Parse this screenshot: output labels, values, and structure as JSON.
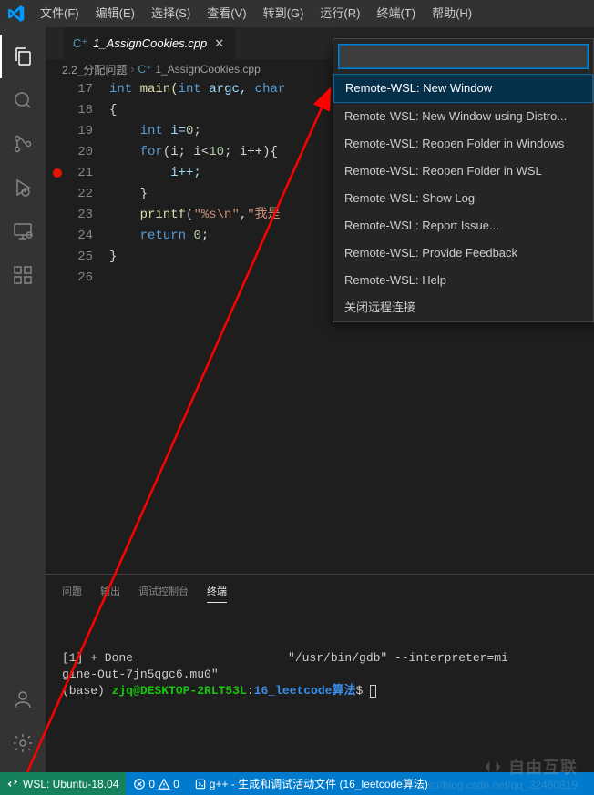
{
  "menubar": [
    "文件(F)",
    "编辑(E)",
    "选择(S)",
    "查看(V)",
    "转到(G)",
    "运行(R)",
    "终端(T)",
    "帮助(H)"
  ],
  "tab": {
    "label": "1_AssignCookies.cpp"
  },
  "breadcrumb": {
    "folder": "2.2_分配问题",
    "file": "1_AssignCookies.cpp"
  },
  "line_numbers": [
    "17",
    "18",
    "19",
    "20",
    "21",
    "22",
    "23",
    "24",
    "25",
    "26"
  ],
  "code": {
    "l17_a": "int",
    "l17_b": " main(",
    "l17_c": "int",
    "l17_d": " argc, ",
    "l17_e": "char",
    "l18": "{",
    "l19_a": "int",
    "l19_b": " i=",
    "l19_c": "0",
    "l19_d": ";",
    "l20_a": "for",
    "l20_b": "(i; i<",
    "l20_c": "10",
    "l20_d": "; i++){",
    "l21_a": "i++;",
    "l22": "}",
    "l23_a": "printf",
    "l23_b": "(",
    "l23_c": "\"%s\\n\"",
    "l23_d": ",",
    "l23_e": "\"我是",
    "l24_a": "return",
    "l24_b": " ",
    "l24_c": "0",
    "l24_d": ";",
    "l25": "}"
  },
  "quickpick": [
    "Remote-WSL: New Window",
    "Remote-WSL: New Window using Distro...",
    "Remote-WSL: Reopen Folder in Windows",
    "Remote-WSL: Reopen Folder in WSL",
    "Remote-WSL: Show Log",
    "Remote-WSL: Report Issue...",
    "Remote-WSL: Provide Feedback",
    "Remote-WSL: Help",
    "关闭远程连接"
  ],
  "panel_tabs": [
    "问题",
    "输出",
    "调试控制台",
    "终端"
  ],
  "terminal": {
    "line1_left": "[1] + Done",
    "line1_right": "\"/usr/bin/gdb\" --interpreter=mi",
    "line2": "gine-Out-7jn5qgc6.mu0\"",
    "line3_base": "(base) ",
    "line3_user": "zjq@DESKTOP-2RLT53L",
    "line3_sep": ":",
    "line3_path": "16_leetcode算法",
    "line3_dollar": "$ "
  },
  "statusbar": {
    "remote": "WSL: Ubuntu-18.04",
    "errors": "0",
    "warnings": "0",
    "build_task": "g++ - 生成和调试活动文件 (16_leetcode算法)"
  },
  "watermark": {
    "brand": "自由互联",
    "url": "https://blog.csdn.net/qq_32460819"
  }
}
